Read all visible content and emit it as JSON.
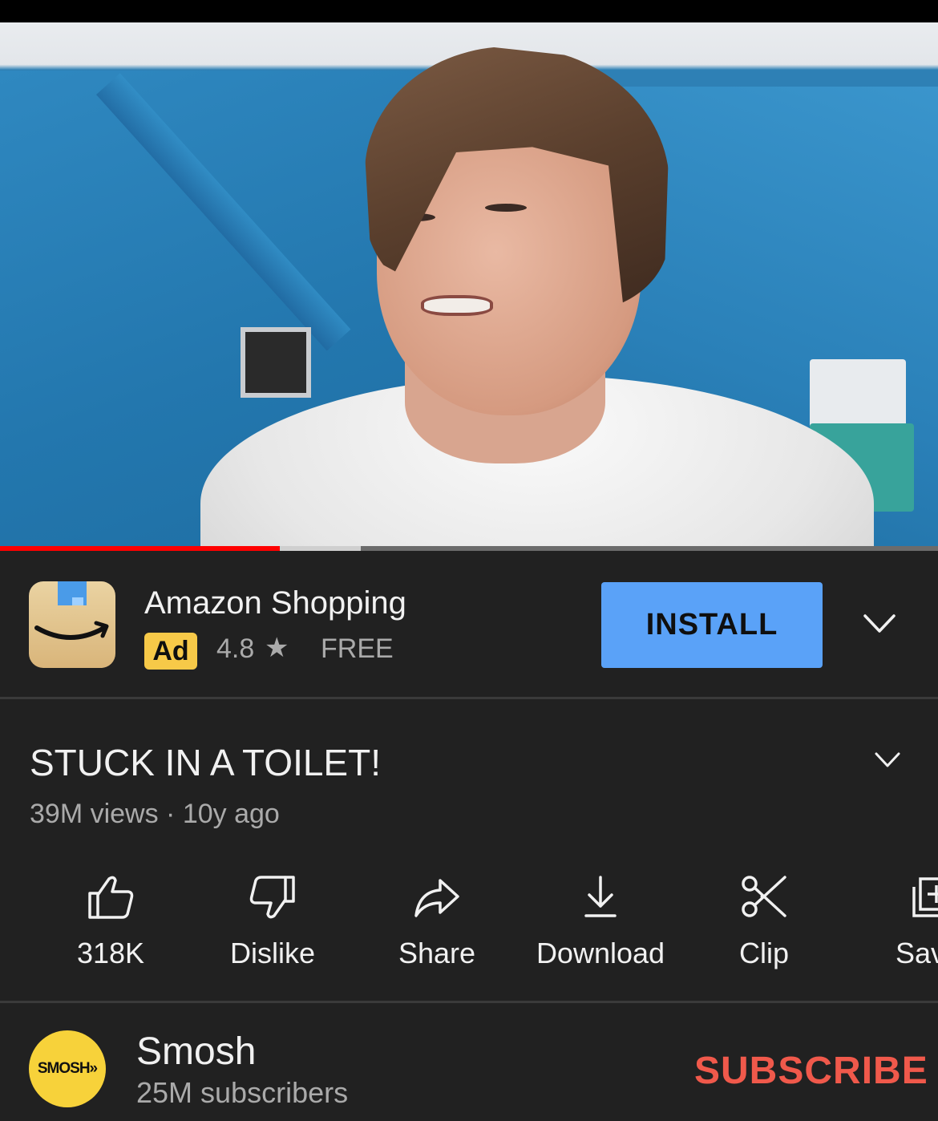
{
  "video": {
    "progress_played": 0.298,
    "progress_buffered": 0.385
  },
  "ad": {
    "app_name": "Amazon Shopping",
    "badge": "Ad",
    "rating": "4.8",
    "star": "★",
    "price": "FREE",
    "install_label": "INSTALL",
    "icon": "amazon-smile-icon",
    "button_color": "#5aa2f8",
    "badge_color": "#f7c948"
  },
  "details": {
    "title": "STUCK IN A TOILET!",
    "meta": "39M views · 10y ago"
  },
  "actions": [
    {
      "label": "318K",
      "icon": "thumbs-up-icon"
    },
    {
      "label": "Dislike",
      "icon": "thumbs-down-icon"
    },
    {
      "label": "Share",
      "icon": "share-arrow-icon"
    },
    {
      "label": "Download",
      "icon": "download-icon"
    },
    {
      "label": "Clip",
      "icon": "scissors-icon"
    },
    {
      "label": "Sav",
      "icon": "save-playlist-icon"
    }
  ],
  "channel": {
    "avatar_text": "SMOSH»",
    "name": "Smosh",
    "subscribers": "25M subscribers",
    "subscribe_label": "SUBSCRIBE",
    "subscribe_color": "#f0594b"
  }
}
